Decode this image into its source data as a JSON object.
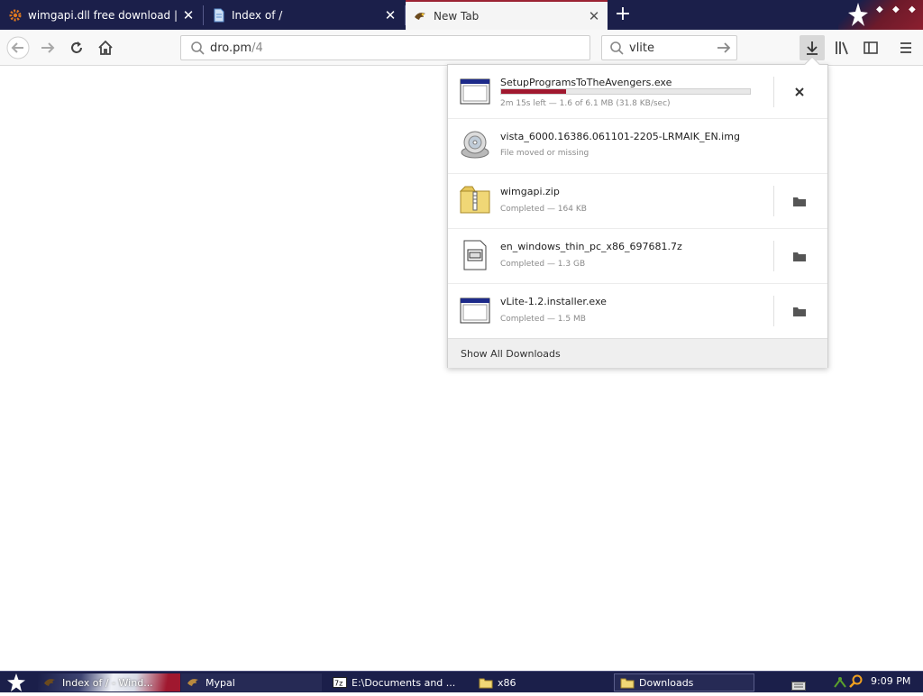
{
  "browser": {
    "tabs": [
      {
        "title": "wimgapi.dll free download | DLL-fil",
        "icon": "gear-icon",
        "active": false
      },
      {
        "title": "Index of /",
        "icon": "document-icon",
        "active": false
      },
      {
        "title": "New Tab",
        "icon": "firefox-icon",
        "active": true
      }
    ],
    "new_tab_label": "+",
    "close_label": "✕",
    "url": "dro.pm/4",
    "url_host": "dro.pm",
    "url_path": "/4",
    "search_value": "vlite",
    "colors": {
      "tabstrip": "#1b1f4a",
      "accent": "#a0182f"
    }
  },
  "downloads": {
    "items": [
      {
        "name": "SetupProgramsToTheAvengers.exe",
        "status": "2m 15s left — 1.6 of 6.1 MB (31.8 KB/sec)",
        "progress_percent": 26,
        "icon": "exe-window-icon",
        "action": "cancel"
      },
      {
        "name": "vista_6000.16386.061101-2205-LRMAIK_EN.img",
        "status": "File moved or missing",
        "icon": "disc-image-icon",
        "action": "none"
      },
      {
        "name": "wimgapi.zip",
        "status": "Completed — 164 KB",
        "icon": "zip-icon",
        "action": "open-folder"
      },
      {
        "name": "en_windows_thin_pc_x86_697681.7z",
        "status": "Completed — 1.3 GB",
        "icon": "7z-icon",
        "action": "open-folder"
      },
      {
        "name": "vLite-1.2.installer.exe",
        "status": "Completed — 1.5 MB",
        "icon": "exe-window-icon",
        "action": "open-folder"
      }
    ],
    "show_all_label": "Show All Downloads"
  },
  "taskbar": {
    "tasks": [
      {
        "label": "Index of / - Wind...",
        "icon": "firefox-icon"
      },
      {
        "label": "Mypal",
        "icon": "firefox-icon"
      },
      {
        "label": "E:\\Documents and ...",
        "icon": "7zip-icon"
      },
      {
        "label": "x86",
        "icon": "folder-icon"
      },
      {
        "label": "Downloads",
        "icon": "folder-icon"
      }
    ],
    "clock": "9:09 PM"
  }
}
